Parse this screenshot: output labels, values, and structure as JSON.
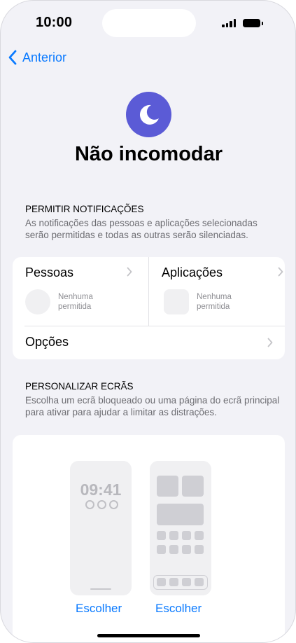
{
  "status_bar": {
    "time": "10:00"
  },
  "nav": {
    "back_label": "Anterior"
  },
  "header": {
    "title": "Não incomodar",
    "icon": "moon-icon",
    "icon_color": "#5b5bd6"
  },
  "notifications": {
    "heading": "PERMITIR NOTIFICAÇÕES",
    "description": "As notificações das pessoas e aplicações selecionadas serão permitidas e todas as outras serão silenciadas.",
    "people": {
      "label": "Pessoas",
      "placeholder": "Nenhuma permitida"
    },
    "apps": {
      "label": "Aplicações",
      "placeholder": "Nenhuma permitida"
    },
    "options": {
      "label": "Opções"
    }
  },
  "screens": {
    "heading": "PERSONALIZAR ECRÃS",
    "description": "Escolha um ecrã bloqueado ou uma página do ecrã principal para ativar para ajudar a limitar as distrações.",
    "lock_preview_time": "09:41",
    "lock_choose": "Escolher",
    "home_choose": "Escolher"
  },
  "colors": {
    "accent": "#0a7aff",
    "background": "#f2f2f7"
  }
}
